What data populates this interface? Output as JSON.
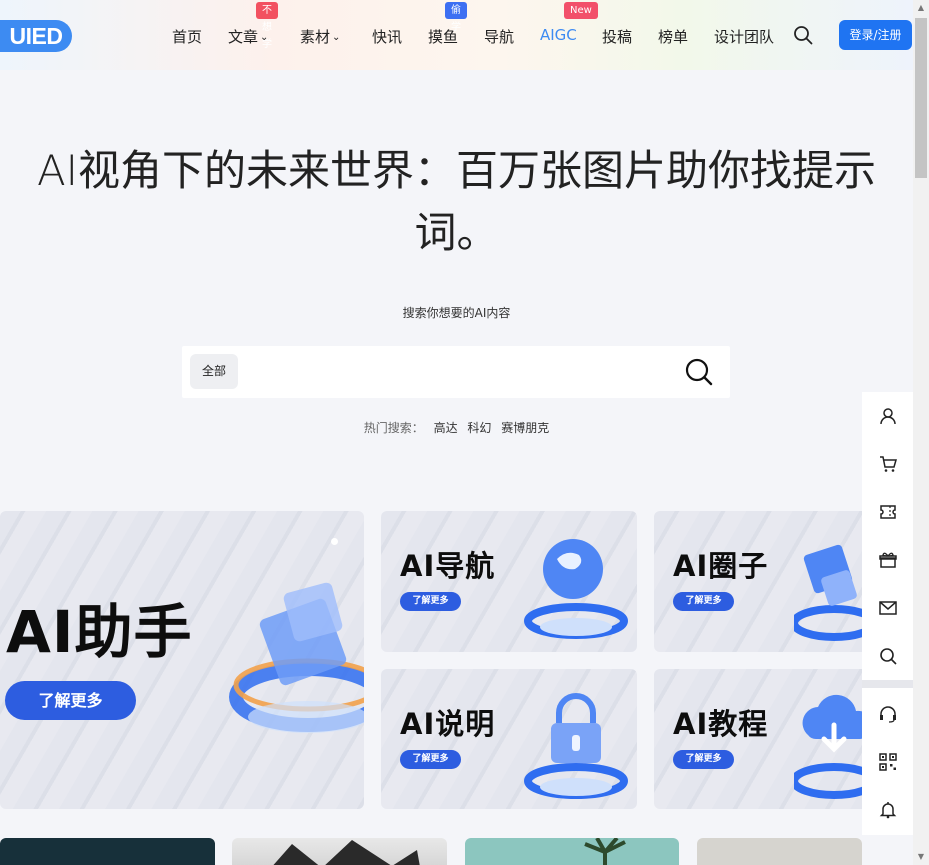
{
  "header": {
    "logo_text": "UIED",
    "nav": [
      {
        "label": "首页"
      },
      {
        "label": "文章",
        "dropdown": true,
        "badge": "不想学"
      },
      {
        "label": "素材",
        "dropdown": true
      },
      {
        "label": "快讯"
      },
      {
        "label": "摸鱼",
        "badge": "偷学"
      },
      {
        "label": "导航"
      },
      {
        "label": "AIGC",
        "active": true,
        "badge": "New"
      },
      {
        "label": "投稿"
      },
      {
        "label": "榜单"
      },
      {
        "label": "设计团队"
      }
    ],
    "login_label": "登录/注册",
    "accent_color": "#1f74f2"
  },
  "hero": {
    "title": "AI视角下的未来世界：百万张图片助你找提示词。",
    "subtitle": "搜索你想要的AI内容",
    "search": {
      "category": "全部",
      "value": "",
      "placeholder": ""
    },
    "hot_label": "热门搜索：",
    "hot_tags": [
      "高达",
      "科幻",
      "赛博朋克"
    ]
  },
  "cards": {
    "main": {
      "title": "AI助手",
      "button": "了解更多"
    },
    "nav": {
      "title": "AI导航",
      "button": "了解更多"
    },
    "circle": {
      "title": "AI圈子",
      "button": "了解更多"
    },
    "guide": {
      "title": "AI说明",
      "button": "了解更多"
    },
    "tutorial": {
      "title": "AI教程",
      "button": "了解更多"
    }
  },
  "toolbar": {
    "items": [
      "user-icon",
      "cart-icon",
      "ticket-icon",
      "gift-icon",
      "mail-icon",
      "search-icon",
      "headset-icon",
      "qrcode-icon",
      "bell-icon"
    ]
  }
}
